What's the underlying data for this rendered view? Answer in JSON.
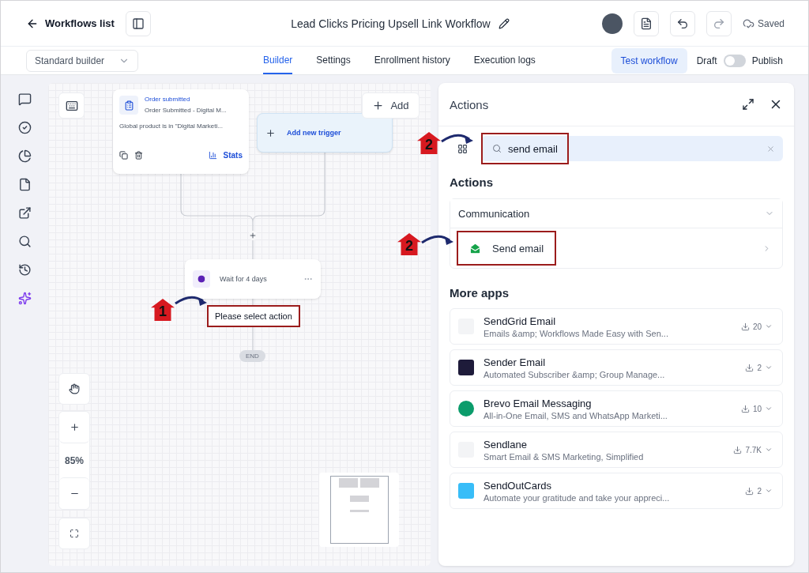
{
  "header": {
    "back_label": "Workflows list",
    "title": "Lead Clicks Pricing Upsell Link Workflow",
    "status": "Saved"
  },
  "toolbar": {
    "builder_select": "Standard builder",
    "tabs": [
      {
        "label": "Builder",
        "selected": true
      },
      {
        "label": "Settings",
        "selected": false
      },
      {
        "label": "Enrollment history",
        "selected": false
      },
      {
        "label": "Execution logs",
        "selected": false
      }
    ],
    "test_button": "Test workflow",
    "draft_label": "Draft",
    "publish": {
      "on": false
    },
    "publish_label": "Publish"
  },
  "canvas": {
    "trigger": {
      "title": "Order submitted",
      "subtitle": "Order Submitted - Digital M...",
      "description": "Global product is in \"Digital Marketi...",
      "stats_label": "Stats"
    },
    "add_trigger_label": "Add new trigger",
    "add_label": "Add",
    "wait_label": "Wait for 4 days",
    "action_placeholder": {
      "label": "Please select action",
      "highlighted": true,
      "marker": "1"
    },
    "end_label": "END",
    "zoom_label": "85%"
  },
  "panel": {
    "title": "Actions",
    "search": {
      "value": "send email",
      "highlighted": true,
      "marker": "2"
    },
    "actions_heading": "Actions",
    "category": {
      "label": "Communication",
      "expanded": true
    },
    "action": {
      "label": "Send email",
      "highlighted": true,
      "marker": "2"
    },
    "more_apps_heading": "More apps",
    "apps": [
      {
        "name": "SendGrid Email",
        "description": "Emails &amp; Workflows Made Easy with Sen...",
        "count": "20",
        "kind": "plain"
      },
      {
        "name": "Sender Email",
        "description": "Automated Subscriber &amp; Group Manage...",
        "count": "2",
        "kind": "dark"
      },
      {
        "name": "Brevo Email Messaging",
        "description": "All-in-One Email, SMS and WhatsApp Marketi...",
        "count": "10",
        "kind": "circle"
      },
      {
        "name": "Sendlane",
        "description": "Smart Email & SMS Marketing, Simplified",
        "count": "7.7K",
        "kind": "plain"
      },
      {
        "name": "SendOutCards",
        "description": "Automate your gratitude and take your appreci...",
        "count": "2",
        "kind": "card"
      }
    ]
  }
}
